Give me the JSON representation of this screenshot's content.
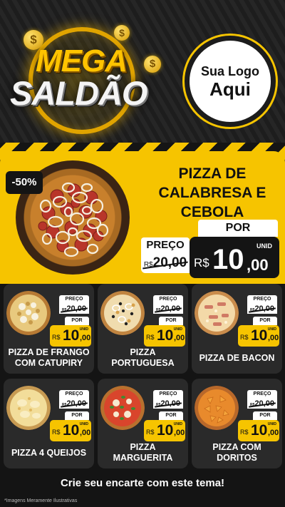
{
  "header": {
    "title_line1": "MEGA",
    "title_line2": "SALDÃO",
    "coin_symbol": "$",
    "logo_line1": "Sua Logo",
    "logo_line2": "Aqui"
  },
  "featured": {
    "discount": "-50%",
    "name": "PIZZA DE CALABRESA E CEBOLA",
    "preco_label": "PREÇO",
    "old_currency": "R$",
    "old_price": "20,00",
    "por_label": "POR",
    "unid_label": "UNID",
    "new_currency": "R$",
    "new_int": "10",
    "new_dec": ",00"
  },
  "card_labels": {
    "preco": "PREÇO",
    "por": "POR",
    "unid": "UNID",
    "currency": "R$"
  },
  "products": [
    {
      "name": "PIZZA DE FRANGO COM CATUPIRY",
      "old_price": "20,00",
      "new_int": "10",
      "new_dec": ",00",
      "icon": "chicken-pizza-icon"
    },
    {
      "name": "PIZZA PORTUGUESA",
      "old_price": "20,00",
      "new_int": "10",
      "new_dec": ",00",
      "icon": "portuguesa-pizza-icon"
    },
    {
      "name": "PIZZA DE BACON",
      "old_price": "20,00",
      "new_int": "10",
      "new_dec": ",00",
      "icon": "bacon-pizza-icon"
    },
    {
      "name": "PIZZA 4 QUEIJOS",
      "old_price": "20,00",
      "new_int": "10",
      "new_dec": ",00",
      "icon": "cheese-pizza-icon"
    },
    {
      "name": "PIZZA MARGUERITA",
      "old_price": "20,00",
      "new_int": "10",
      "new_dec": ",00",
      "icon": "margherita-pizza-icon"
    },
    {
      "name": "PIZZA COM DORITOS",
      "old_price": "20,00",
      "new_int": "10",
      "new_dec": ",00",
      "icon": "doritos-pizza-icon"
    }
  ],
  "footer": {
    "cta": "Crie seu encarte com este tema!",
    "note": "*Imagens Meramente Ilustrativas"
  },
  "colors": {
    "accent_yellow": "#f6c400",
    "dark": "#141414",
    "card_bg": "#2a2a2a"
  }
}
